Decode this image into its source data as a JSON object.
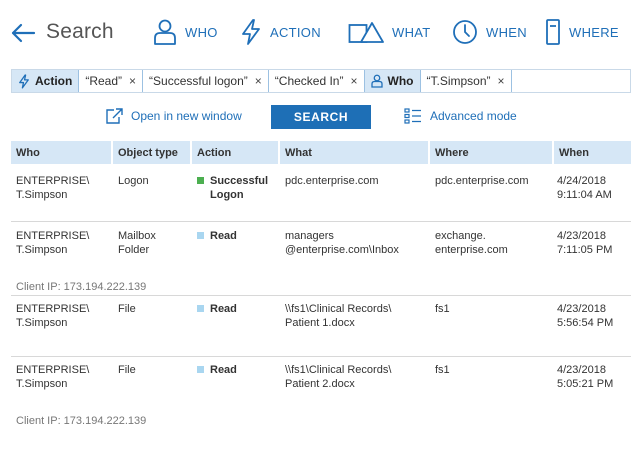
{
  "header": {
    "title": "Search",
    "nav": [
      {
        "label": "WHO",
        "icon": "person-icon"
      },
      {
        "label": "ACTION",
        "icon": "lightning-icon"
      },
      {
        "label": "WHAT",
        "icon": "shapes-icon"
      },
      {
        "label": "WHEN",
        "icon": "clock-icon"
      },
      {
        "label": "WHERE",
        "icon": "server-icon"
      }
    ]
  },
  "filters": {
    "action_label": "Action",
    "action_values": [
      "“Read”",
      "“Successful logon”",
      "“Checked In”"
    ],
    "who_label": "Who",
    "who_values": [
      "“T.Simpson”"
    ],
    "remove_symbol": "×"
  },
  "actions": {
    "open_new": "Open in new window",
    "search": "SEARCH",
    "advanced": "Advanced mode"
  },
  "table": {
    "columns": [
      "Who",
      "Object type",
      "Action",
      "What",
      "Where",
      "When"
    ],
    "rows": [
      {
        "who": [
          "ENTERPRISE\\",
          "T.Simpson"
        ],
        "object_type": [
          "Logon"
        ],
        "action": [
          "Successful",
          "Logon"
        ],
        "action_color": "#4caf50",
        "what": [
          "pdc.enterprise.com"
        ],
        "where": [
          "pdc.enterprise.com"
        ],
        "when": [
          "4/24/2018",
          "9:11:04 AM"
        ],
        "client_ip": ""
      },
      {
        "who": [
          "ENTERPRISE\\",
          "T.Simpson"
        ],
        "object_type": [
          "Mailbox",
          "Folder"
        ],
        "action": [
          "Read"
        ],
        "action_color": "#a9d6f0",
        "what": [
          "managers",
          "@enterprise.com\\Inbox"
        ],
        "where": [
          "exchange.",
          "enterprise.com"
        ],
        "when": [
          "4/23/2018",
          "7:11:05 PM"
        ],
        "client_ip": "Client IP: 173.194.222.139"
      },
      {
        "who": [
          "ENTERPRISE\\",
          "T.Simpson"
        ],
        "object_type": [
          "File"
        ],
        "action": [
          "Read"
        ],
        "action_color": "#a9d6f0",
        "what": [
          "\\\\fs1\\Clinical Records\\",
          "Patient 1.docx"
        ],
        "where": [
          "fs1"
        ],
        "when": [
          "4/23/2018",
          "5:56:54 PM"
        ],
        "client_ip": ""
      },
      {
        "who": [
          "ENTERPRISE\\",
          "T.Simpson"
        ],
        "object_type": [
          "File"
        ],
        "action": [
          "Read"
        ],
        "action_color": "#a9d6f0",
        "what": [
          "\\\\fs1\\Clinical Records\\",
          "Patient 2.docx"
        ],
        "where": [
          "fs1"
        ],
        "when": [
          "4/23/2018",
          "5:05:21 PM"
        ],
        "client_ip": "Client IP: 173.194.222.139"
      }
    ]
  },
  "colors": {
    "accent": "#1f6fb8",
    "button": "#1e6fb6",
    "header_bg": "#d6e7f6",
    "success": "#4caf50",
    "read": "#a9d6f0"
  }
}
